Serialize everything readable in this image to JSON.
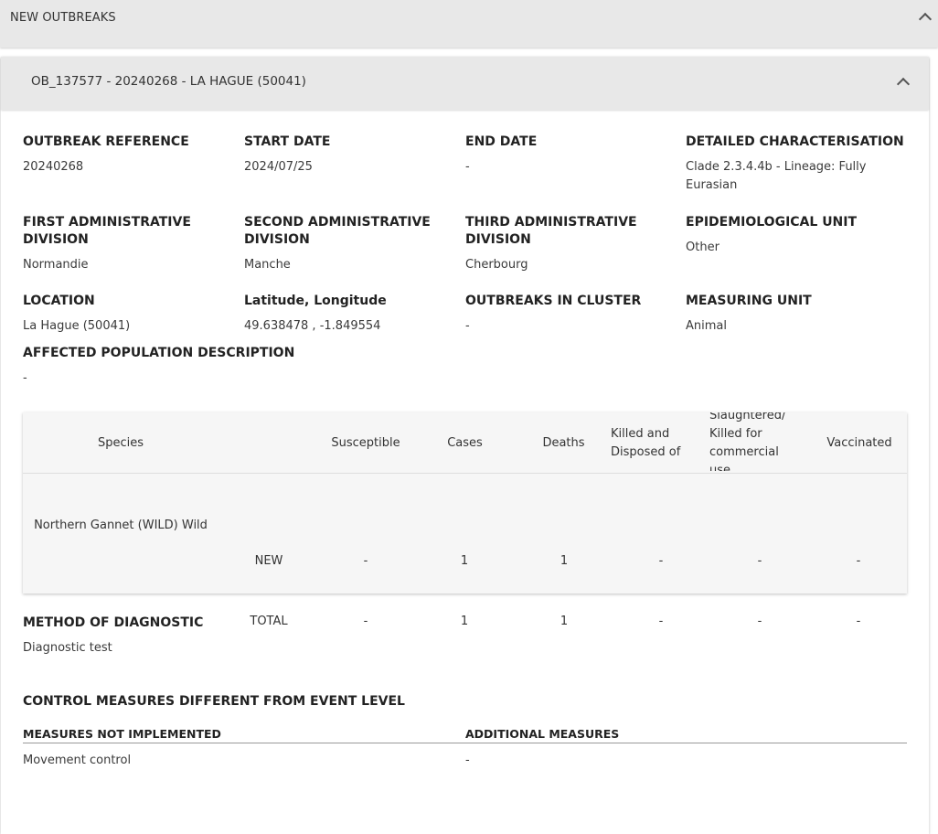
{
  "section": {
    "title": "NEW OUTBREAKS"
  },
  "outbreak": {
    "title": "OB_137577 - 20240268 - LA HAGUE (50041)",
    "fields": [
      {
        "label": "OUTBREAK REFERENCE",
        "value": "20240268"
      },
      {
        "label": "START DATE",
        "value": "2024/07/25"
      },
      {
        "label": "END DATE",
        "value": "-"
      },
      {
        "label": "DETAILED CHARACTERISATION",
        "value": "Clade 2.3.4.4b - Lineage: Fully Eurasian"
      },
      {
        "label": "FIRST ADMINISTRATIVE DIVISION",
        "value": "Normandie"
      },
      {
        "label": "SECOND ADMINISTRATIVE DIVISION",
        "value": "Manche"
      },
      {
        "label": "THIRD ADMINISTRATIVE DIVISION",
        "value": "Cherbourg"
      },
      {
        "label": "EPIDEMIOLOGICAL UNIT",
        "value": "Other"
      },
      {
        "label": "LOCATION",
        "value": "La Hague (50041)"
      },
      {
        "label": "Latitude, Longitude",
        "value": "49.638478 , -1.849554"
      },
      {
        "label": "OUTBREAKS IN CLUSTER",
        "value": "-"
      },
      {
        "label": "MEASURING UNIT",
        "value": "Animal"
      },
      {
        "label": "AFFECTED POPULATION DESCRIPTION",
        "value": "-"
      }
    ]
  },
  "table": {
    "headers": {
      "species": "Species",
      "susceptible": "Susceptible",
      "cases": "Cases",
      "deaths": "Deaths",
      "killed": "Killed and Disposed of",
      "slaughtered": "Slaughtered/ Killed for commercial use",
      "vaccinated": "Vaccinated"
    },
    "species_name": "Northern Gannet (WILD) Wild",
    "rows": [
      {
        "label": "NEW",
        "susceptible": "-",
        "cases": "1",
        "deaths": "1",
        "killed": "-",
        "slaughtered": "-",
        "vaccinated": "-"
      },
      {
        "label": "TOTAL",
        "susceptible": "-",
        "cases": "1",
        "deaths": "1",
        "killed": "-",
        "slaughtered": "-",
        "vaccinated": "-"
      }
    ]
  },
  "diagnostic": {
    "label": "METHOD OF DIAGNOSTIC",
    "value": "Diagnostic test"
  },
  "control": {
    "title": "CONTROL MEASURES DIFFERENT FROM EVENT LEVEL",
    "not_implemented_header": "MEASURES NOT IMPLEMENTED",
    "additional_header": "ADDITIONAL MEASURES",
    "not_implemented_value": "Movement control",
    "additional_value": "-"
  }
}
